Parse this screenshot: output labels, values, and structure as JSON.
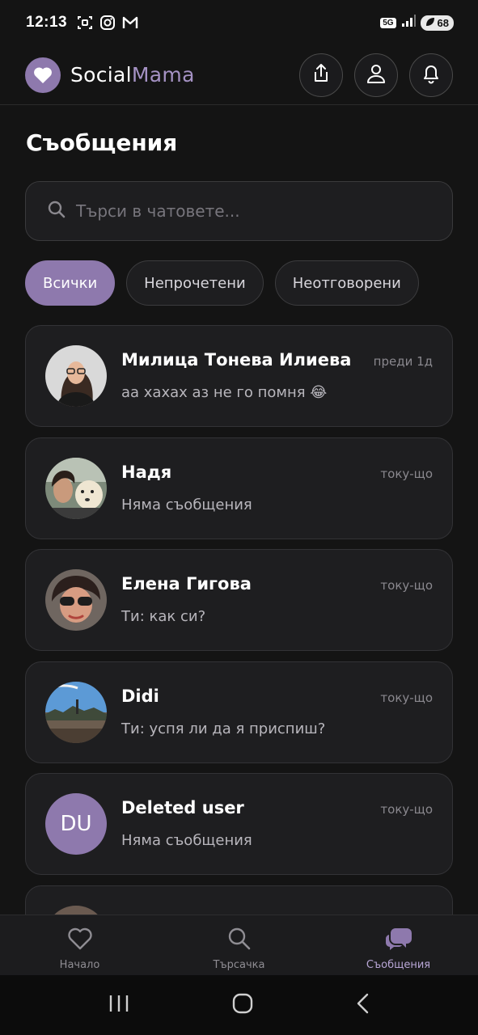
{
  "status_bar": {
    "time": "12:13",
    "network": "5G",
    "battery": "68",
    "left_icons": [
      "screenshot-icon",
      "instagram-icon",
      "gmail-icon"
    ]
  },
  "header": {
    "brand_part1": "Social",
    "brand_part2": "Mama",
    "accent_color": "#8e79ad",
    "actions": [
      "share-icon",
      "profile-icon",
      "bell-icon"
    ]
  },
  "page": {
    "title": "Съобщения"
  },
  "search": {
    "placeholder": "Търси в чатовете..."
  },
  "filters": [
    {
      "label": "Всички",
      "active": true
    },
    {
      "label": "Непрочетени",
      "active": false
    },
    {
      "label": "Неотговорени",
      "active": false
    }
  ],
  "chats": [
    {
      "name": "Милица Тонева Илиева",
      "time": "преди 1д",
      "message": "аа хахах аз не го помня 😂"
    },
    {
      "name": "Надя",
      "time": "току-що",
      "message": "Няма съобщения"
    },
    {
      "name": "Елена Гигова",
      "time": "току-що",
      "message": "Ти: как си?"
    },
    {
      "name": "Didi",
      "time": "току-що",
      "message": "Ти: успя ли да я приспиш?"
    },
    {
      "name": "Deleted user",
      "time": "току-що",
      "message": "Няма съобщения",
      "initials": "DU"
    }
  ],
  "bottom_nav": [
    {
      "label": "Начало",
      "icon": "heart-icon",
      "active": false
    },
    {
      "label": "Търсачка",
      "icon": "search-icon",
      "active": false
    },
    {
      "label": "Съобщения",
      "icon": "chat-bubbles-icon",
      "active": true
    }
  ]
}
